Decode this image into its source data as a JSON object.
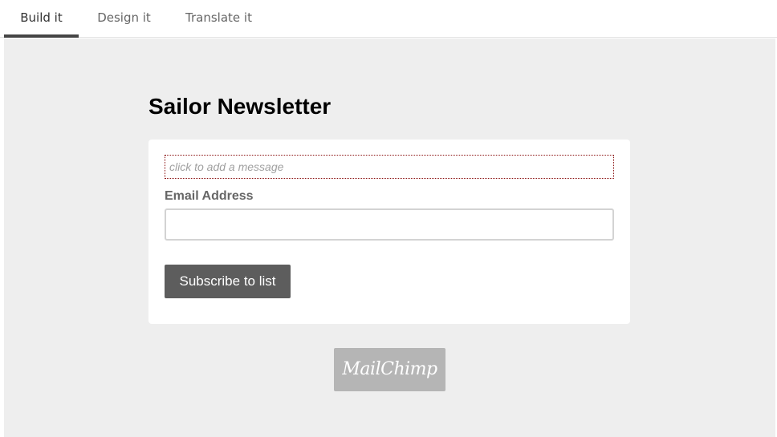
{
  "tabs": [
    {
      "label": "Build it",
      "active": true
    },
    {
      "label": "Design it",
      "active": false
    },
    {
      "label": "Translate it",
      "active": false
    }
  ],
  "form": {
    "title": "Sailor Newsletter",
    "message_placeholder": "click to add a message",
    "email_label": "Email Address",
    "email_value": "",
    "subscribe_label": "Subscribe to list"
  },
  "footer": {
    "logo_text": "MailChimp"
  },
  "colors": {
    "canvas_background": "#eeeeee",
    "button_background": "#5d5d5d",
    "active_tab_indicator": "#454545",
    "logo_background": "#b5b5b5",
    "message_border": "#8a1010"
  }
}
